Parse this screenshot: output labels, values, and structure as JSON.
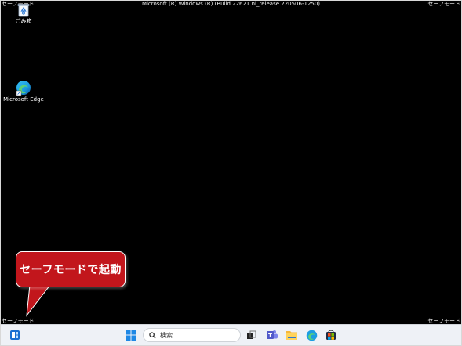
{
  "screen": {
    "corner_labels": {
      "top_left": "セーフモード",
      "top_right": "セーフモード",
      "bottom_left": "セーフモード",
      "bottom_right": "セーフモード"
    },
    "build_text": "Microsoft (R) Windows (R) (Build 22621.ni_release.220506-1250)"
  },
  "desktop": {
    "icons": [
      {
        "label": "ごみ箱",
        "icon": "recycle-bin-icon"
      },
      {
        "label": "Microsoft Edge",
        "icon": "edge-icon"
      }
    ]
  },
  "callout": {
    "text": "セーフモードで起動",
    "color": "#c2161c"
  },
  "taskbar": {
    "search_placeholder": "検索",
    "items": [
      "widgets-icon",
      "start-icon",
      "search-icon",
      "task-view-icon",
      "teams-icon",
      "file-explorer-icon",
      "edge-icon",
      "store-icon"
    ]
  }
}
